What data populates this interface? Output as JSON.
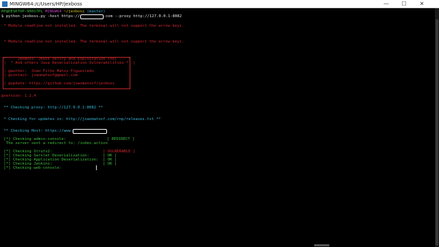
{
  "window": {
    "title": "MINGW64:/c/Users/HP/jexboss",
    "minimize_glyph": "—",
    "maximize_glyph": "☐",
    "close_glyph": "✕"
  },
  "terminal": {
    "prompt_user": "HP@DESKTOP-9001TPL",
    "prompt_env": "MINGW64",
    "prompt_path": "~/jexboss",
    "prompt_branch": "(master)",
    "cmd_prefix": "$ python jexboss.py -host https://",
    "cmd_suffix": ".com --proxy http://127.0.0.1:8082",
    "warn1": " * Module readline not installed. The terminal will not support the arrow keys.",
    "warn2": " * Module readline not installed. The terminal will not support the arrow keys.",
    "banner_title": " * --- JexBoss: Jboss verify and Exploitation Tool --- *",
    "banner_subtitle": " |  * And others Java Deserialization Vulnerabilities *  |",
    "banner_author": " | @author:  João Filho Matos Figueiredo",
    "banner_contact": " | @contact: joaomatosf@gmail.com",
    "banner_update": " | @update: https://github.com/joaomatosf/jexboss",
    "version": "@version: 1.2.4",
    "checking_proxy": " ** Checking proxy: http://127.0.0.1:8082 **",
    "checking_updates": " * Checking for updates in: http://joaomatosf.com/rnp/releases.txt **",
    "checking_host": " ** Checking Host: https://www.",
    "admin_console": " [*] Checking admin-console:",
    "admin_status": "[ REDIRECT ]",
    "redirect_msg": "  The server sent a redirect to: /index.action",
    "checks": [
      {
        "label": " [*] Checking Struts2:",
        "status": "[ VULNERABLE ]"
      },
      {
        "label": " [*] Checking Servlet Deserialization:",
        "status": "[ OK ]"
      },
      {
        "label": " [*] Checking Application Deserialization:",
        "status": "[ OK ]"
      },
      {
        "label": " [*] Checking Jenkins:",
        "status": "[ OK ]"
      },
      {
        "label": " [*] Checking web-console:",
        "status": ""
      }
    ]
  },
  "colors": {
    "red": "#d2262c",
    "cyan": "#38b7d7",
    "green": "#3fbf3f",
    "magenta": "#c23fc2",
    "yellow": "#d8c72c",
    "white": "#e6e6e6"
  }
}
